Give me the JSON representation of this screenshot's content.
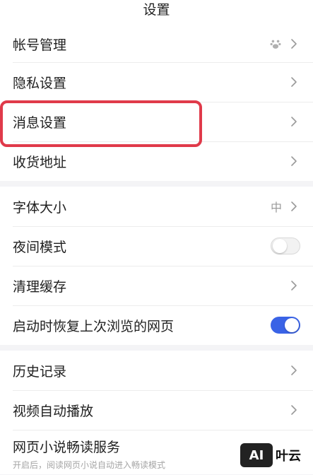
{
  "header": {
    "title": "设置"
  },
  "group1": {
    "items": [
      {
        "label": "帐号管理",
        "icon": "baidu-paw-icon"
      },
      {
        "label": "隐私设置"
      },
      {
        "label": "消息设置"
      },
      {
        "label": "收货地址"
      }
    ]
  },
  "group2": {
    "items": [
      {
        "label": "字体大小",
        "value": "中"
      },
      {
        "label": "夜间模式",
        "toggle": "off"
      },
      {
        "label": "清理缓存"
      },
      {
        "label": "启动时恢复上次浏览的网页",
        "toggle": "on"
      }
    ]
  },
  "group3": {
    "items": [
      {
        "label": "历史记录"
      },
      {
        "label": "视频自动播放"
      },
      {
        "label": "网页小说畅读服务",
        "subtitle": "开启后，阅读网页小说自动进入畅读模式"
      }
    ]
  },
  "highlight": {
    "color": "#e03a4a",
    "target": "消息设置"
  },
  "colors": {
    "accent": "#3a63e6",
    "background": "#f4f4f6"
  },
  "watermark": {
    "badge": "AI",
    "text": "叶云"
  }
}
